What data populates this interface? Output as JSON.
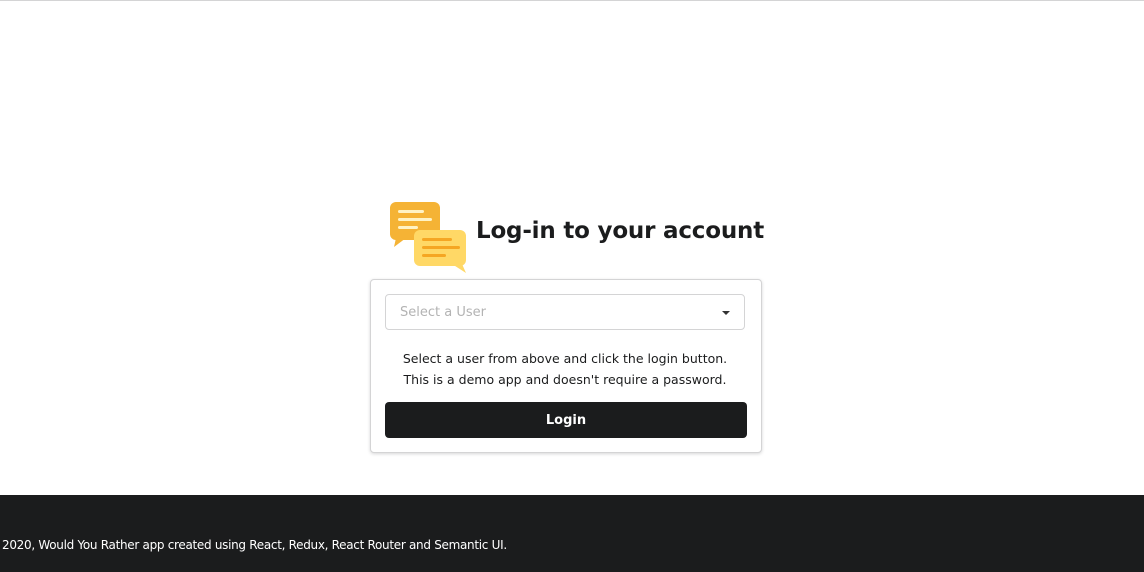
{
  "login": {
    "title": "Log-in to your account",
    "logo_icon": "chat-bubbles-icon",
    "select_placeholder": "Select a User",
    "help_line_1": "Select a user from above and click the login button.",
    "help_line_2": "This is a demo app and doesn't require a password.",
    "login_label": "Login"
  },
  "footer": {
    "text": "2020, Would You Rather app created using React, Redux, React Router and Semantic UI."
  },
  "colors": {
    "button_bg": "#1b1c1d",
    "footer_bg": "#1b1c1d",
    "logo_orange": "#f5b335",
    "logo_yellow": "#ffd866"
  }
}
